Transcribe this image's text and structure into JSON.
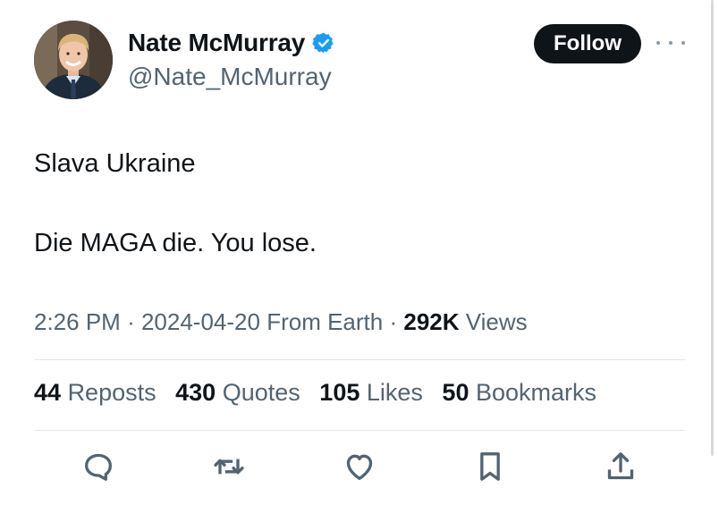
{
  "author": {
    "display_name": "Nate McMurray",
    "handle": "@Nate_McMurray",
    "verified": true
  },
  "header": {
    "follow_label": "Follow",
    "more_icon": "more-horizontal-icon"
  },
  "tweet": {
    "lines": [
      "Slava Ukraine",
      "Die MAGA die. You lose."
    ]
  },
  "meta": {
    "time": "2:26 PM",
    "sep1": "·",
    "date": "2024-04-20",
    "location": "From Earth",
    "sep2": "·",
    "views_count": "292K",
    "views_label": "Views"
  },
  "stats": {
    "reposts_count": "44",
    "reposts_label": "Reposts",
    "quotes_count": "430",
    "quotes_label": "Quotes",
    "likes_count": "105",
    "likes_label": "Likes",
    "bookmarks_count": "50",
    "bookmarks_label": "Bookmarks"
  },
  "actions": [
    "reply-icon",
    "repost-icon",
    "like-icon",
    "bookmark-icon",
    "share-icon"
  ],
  "colors": {
    "text": "#0f1419",
    "secondary": "#536471",
    "verified": "#1d9bf0",
    "follow_bg": "#0f1419",
    "divider": "#e1e6ea"
  }
}
